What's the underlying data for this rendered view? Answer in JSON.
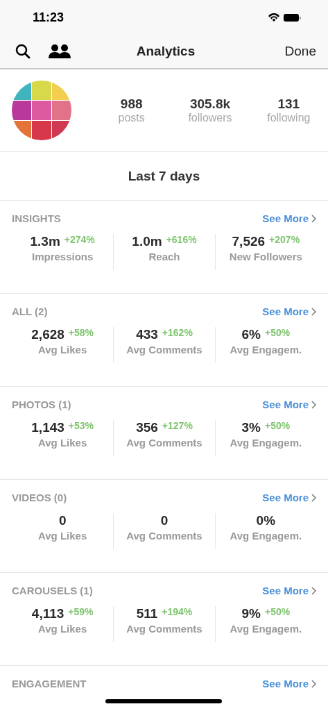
{
  "status_bar": {
    "time": "11:23"
  },
  "nav": {
    "title": "Analytics",
    "done": "Done"
  },
  "profile": {
    "stats": [
      {
        "value": "988",
        "label": "posts"
      },
      {
        "value": "305.8k",
        "label": "followers"
      },
      {
        "value": "131",
        "label": "following"
      }
    ]
  },
  "period": "Last 7 days",
  "sections": [
    {
      "title": "INSIGHTS",
      "see_more": "See More",
      "metrics": [
        {
          "value": "1.3m",
          "change": "+274%",
          "label": "Impressions"
        },
        {
          "value": "1.0m",
          "change": "+616%",
          "label": "Reach"
        },
        {
          "value": "7,526",
          "change": "+207%",
          "label": "New Followers"
        }
      ]
    },
    {
      "title": "ALL (2)",
      "see_more": "See More",
      "metrics": [
        {
          "value": "2,628",
          "change": "+58%",
          "label": "Avg Likes"
        },
        {
          "value": "433",
          "change": "+162%",
          "label": "Avg Comments"
        },
        {
          "value": "6%",
          "change": "+50%",
          "label": "Avg Engagem."
        }
      ]
    },
    {
      "title": "PHOTOS (1)",
      "see_more": "See More",
      "metrics": [
        {
          "value": "1,143",
          "change": "+53%",
          "label": "Avg Likes"
        },
        {
          "value": "356",
          "change": "+127%",
          "label": "Avg Comments"
        },
        {
          "value": "3%",
          "change": "+50%",
          "label": "Avg Engagem."
        }
      ]
    },
    {
      "title": "VIDEOS (0)",
      "see_more": "See More",
      "metrics": [
        {
          "value": "0",
          "label": "Avg Likes"
        },
        {
          "value": "0",
          "label": "Avg Comments"
        },
        {
          "value": "0%",
          "label": "Avg Engagem."
        }
      ]
    },
    {
      "title": "CAROUSELS (1)",
      "see_more": "See More",
      "metrics": [
        {
          "value": "4,113",
          "change": "+59%",
          "label": "Avg Likes"
        },
        {
          "value": "511",
          "change": "+194%",
          "label": "Avg Comments"
        },
        {
          "value": "9%",
          "change": "+50%",
          "label": "Avg Engagem."
        }
      ]
    },
    {
      "title": "ENGAGEMENT",
      "see_more": "See More"
    }
  ]
}
